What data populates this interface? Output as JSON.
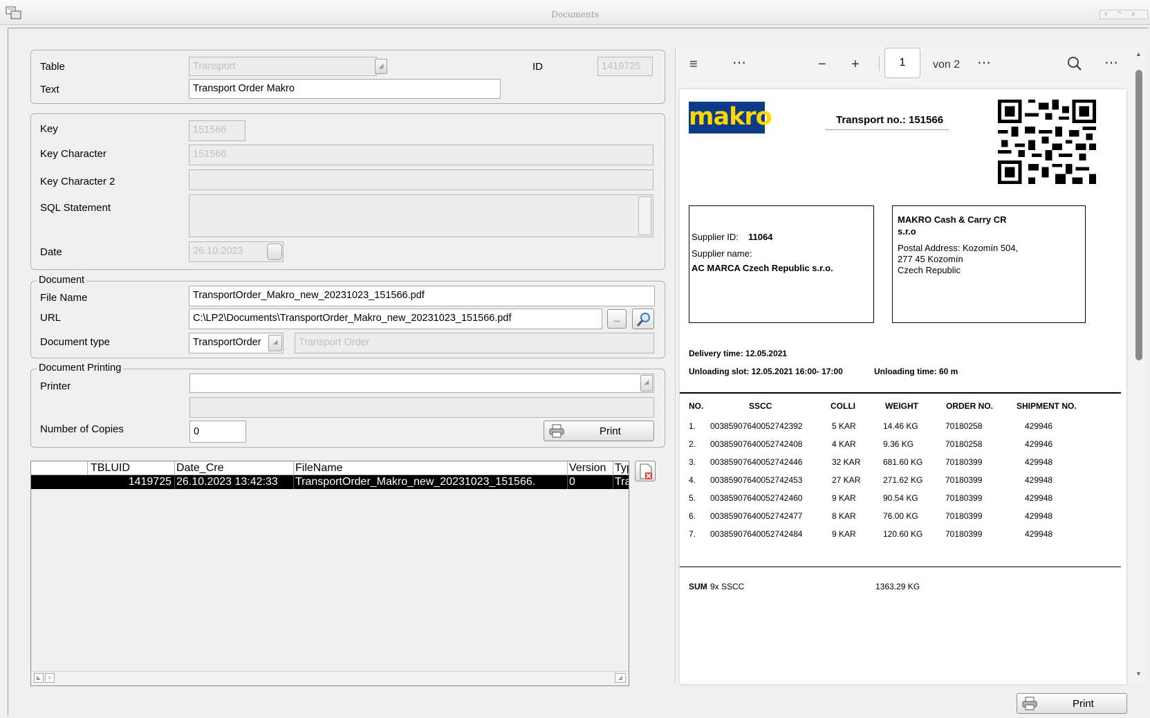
{
  "window": {
    "title": "Documents",
    "controls": "v ^ x"
  },
  "record": {
    "table_label": "Table",
    "table_value": "Transport",
    "id_label": "ID",
    "id_value": "1419725",
    "text_label": "Text",
    "text_value": "Transport Order Makro"
  },
  "key": {
    "key_label": "Key",
    "key_value": "151566",
    "key_char_label": "Key Character",
    "key_char_value": "151566",
    "key_char2_label": "Key Character 2",
    "key_char2_value": "",
    "sql_label": "SQL Statement",
    "sql_value": "",
    "date_label": "Date",
    "date_value": "26.10.2023"
  },
  "document": {
    "legend": "Document",
    "file_name_label": "File Name",
    "file_name_value": "TransportOrder_Makro_new_20231023_151566.pdf",
    "url_label": "URL",
    "url_value": "C:\\LP2\\Documents\\TransportOrder_Makro_new_20231023_151566.pdf",
    "browse_label": "...",
    "doctype_label": "Document type",
    "doctype_value": "TransportOrder",
    "doctype_desc": "Transport Order"
  },
  "printing": {
    "legend": "Document Printing",
    "printer_label": "Printer",
    "printer_value": "",
    "printer_desc": "",
    "copies_label": "Number of Copies",
    "copies_value": "0",
    "print_label": "Print"
  },
  "grid": {
    "columns": [
      "TBLUID",
      "Date_Cre",
      "FileName",
      "Version",
      "Type"
    ],
    "rows": [
      {
        "tbluid": "1419725",
        "date_cre": "26.10.2023 13:42:33",
        "filename": "TransportOrder_Makro_new_20231023_151566.",
        "version": "0",
        "type": "Transpo"
      }
    ]
  },
  "viewer": {
    "page_current": "1",
    "page_of": "von 2",
    "pdf": {
      "logo": "makro",
      "transport_no": "Transport no.: 151566",
      "supplier_id_label": "Supplier ID:",
      "supplier_id": "11064",
      "supplier_name_label": "Supplier name:",
      "supplier_name": "AC MARCA Czech Republic s.r.o.",
      "recipient_name": "MAKRO Cash & Carry CR",
      "recipient_name2": "s.r.o",
      "address_1": "Postal Address: Kozomín 504,",
      "address_2": "277 45 Kozomín",
      "address_3": "Czech Republic",
      "delivery_time": "Delivery time: 12.05.2021",
      "unloading_slot": "Unloading slot: 12.05.2021 16:00- 17:00",
      "unloading_time": "Unloading time: 60 m",
      "table_headers": [
        "NO.",
        "SSCC",
        "COLLI",
        "WEIGHT",
        "ORDER NO.",
        "SHIPMENT NO."
      ],
      "table_rows": [
        [
          "1.",
          "00385907640052742392",
          "5 KAR",
          "14.46 KG",
          "70180258",
          "429946"
        ],
        [
          "2.",
          "00385907640052742408",
          "4 KAR",
          "9.36 KG",
          "70180258",
          "429946"
        ],
        [
          "3.",
          "00385907640052742446",
          "32 KAR",
          "681.60 KG",
          "70180399",
          "429948"
        ],
        [
          "4.",
          "00385907640052742453",
          "27 KAR",
          "271.62 KG",
          "70180399",
          "429948"
        ],
        [
          "5.",
          "00385907640052742460",
          "9 KAR",
          "90.54 KG",
          "70180399",
          "429948"
        ],
        [
          "6.",
          "00385907640052742477",
          "8 KAR",
          "76.00 KG",
          "70180399",
          "429948"
        ],
        [
          "7.",
          "00385907640052742484",
          "9 KAR",
          "120.60 KG",
          "70180399",
          "429948"
        ]
      ],
      "sum_label": "SUM",
      "sum_count": "9x SSCC",
      "sum_weight": "1363.29 KG"
    }
  },
  "footer": {
    "print_label": "Print"
  }
}
